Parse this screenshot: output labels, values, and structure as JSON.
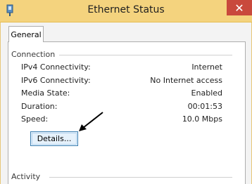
{
  "window": {
    "title": "Ethernet Status",
    "close_symbol": "✕",
    "close_icon": "close-icon",
    "title_icon": "network-adapter-icon"
  },
  "tabs": [
    {
      "label": "General",
      "selected": true
    }
  ],
  "connection": {
    "group_label": "Connection",
    "rows": [
      {
        "label": "IPv4 Connectivity:",
        "value": "Internet"
      },
      {
        "label": "IPv6 Connectivity:",
        "value": "No Internet access"
      },
      {
        "label": "Media State:",
        "value": "Enabled"
      },
      {
        "label": "Duration:",
        "value": "00:01:53"
      },
      {
        "label": "Speed:",
        "value": "10.0 Mbps"
      }
    ],
    "details_button": "Details..."
  },
  "activity": {
    "group_label": "Activity"
  },
  "annotation": {
    "icon": "arrow-icon",
    "color": "#000000"
  },
  "colors": {
    "titlebar": "#f4d37e",
    "close": "#c9493c"
  }
}
